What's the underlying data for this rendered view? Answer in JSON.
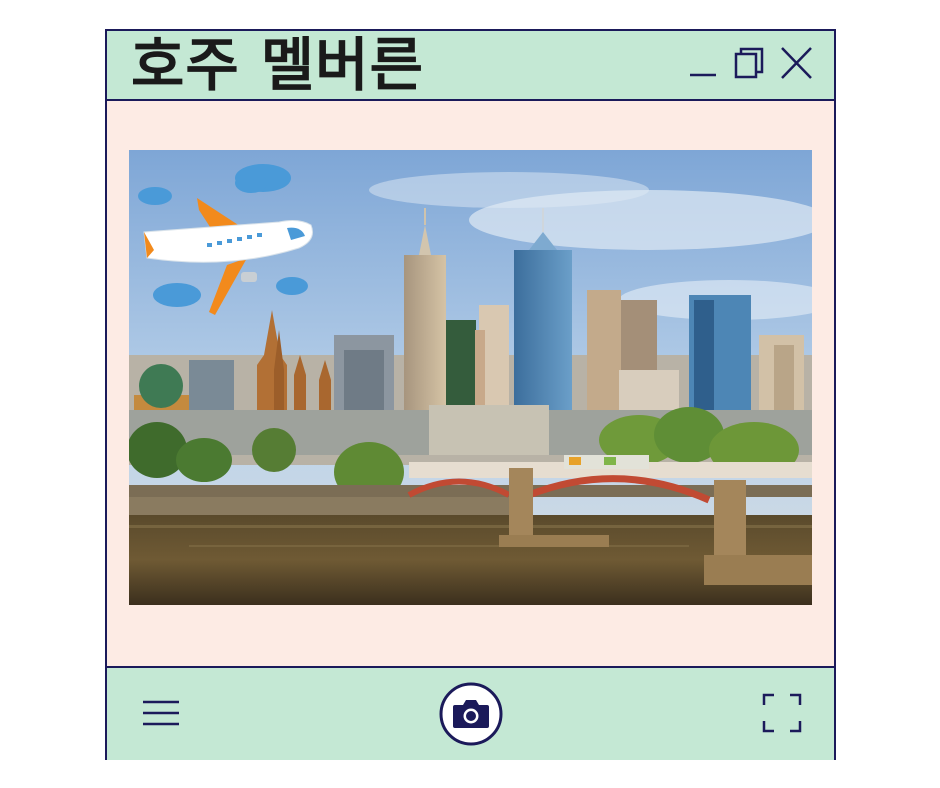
{
  "window": {
    "title": "호주 멜버른",
    "controls": {
      "minimize_icon": "minimize-icon",
      "restore_icon": "restore-icon",
      "close_icon": "close-icon"
    }
  },
  "photo": {
    "subject": "city-skyline-photo",
    "overlay_icon": "airplane-icon"
  },
  "toolbar": {
    "menu_icon": "hamburger-menu-icon",
    "camera_icon": "camera-icon",
    "fullscreen_icon": "fullscreen-icon"
  },
  "colors": {
    "titlebar": "#c4e8d4",
    "border": "#1b1a5a",
    "content_bg": "#fdebe4",
    "accent_navy": "#1b1a5a"
  }
}
